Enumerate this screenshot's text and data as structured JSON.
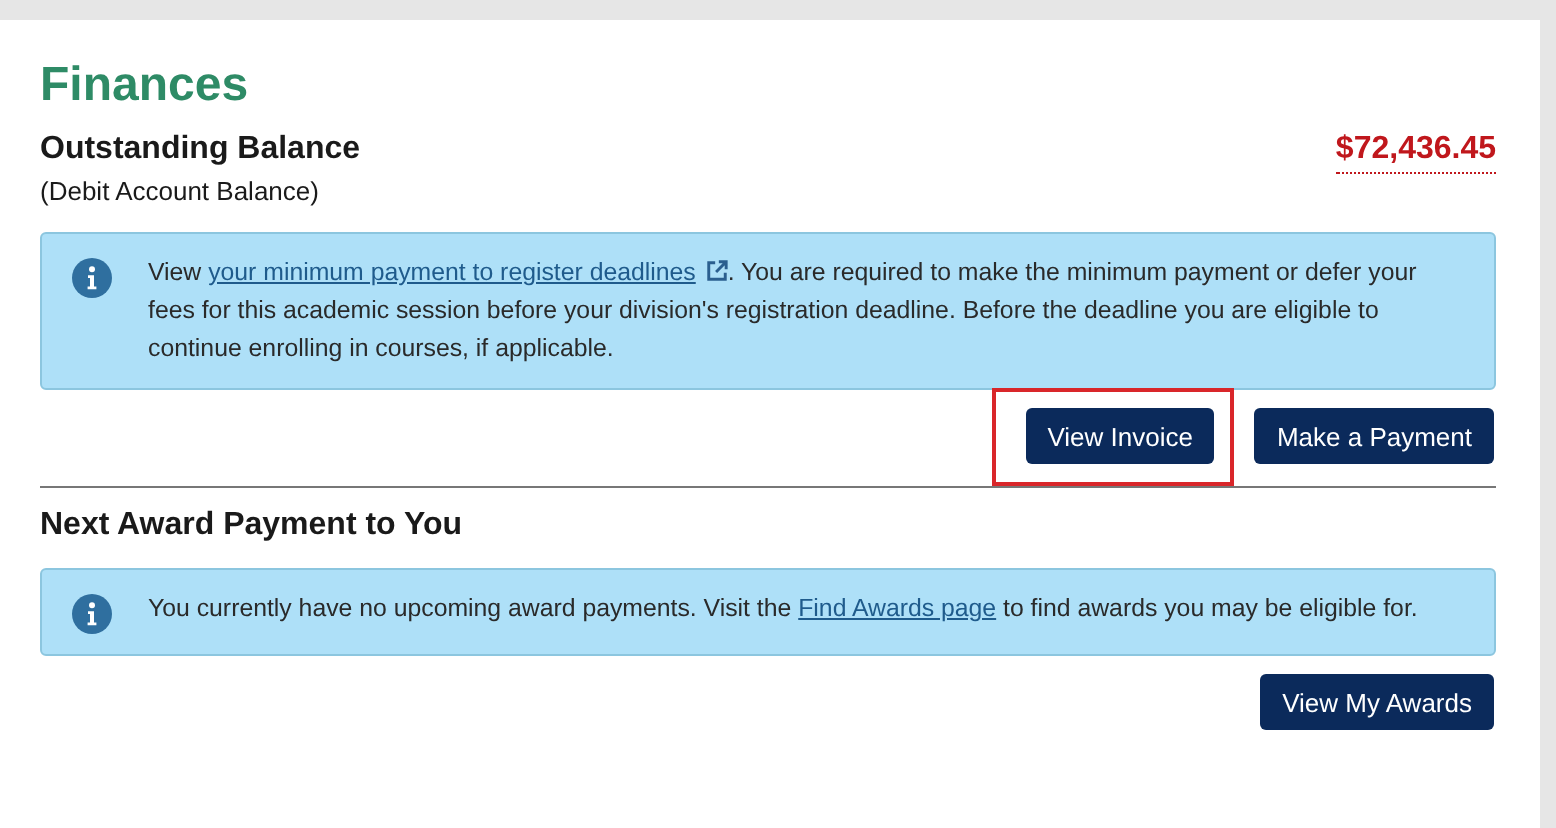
{
  "title": "Finances",
  "balance": {
    "label": "Outstanding Balance",
    "sublabel": "(Debit Account Balance)",
    "amount": "$72,436.45"
  },
  "balance_notice": {
    "before": "View ",
    "link": "your minimum payment to register deadlines",
    "external": true,
    "after": ". You are required to make the minimum payment or defer your fees for this academic session before your division's registration deadline. Before the deadline you are eligible to continue enrolling in courses, if applicable."
  },
  "balance_buttons": [
    {
      "label": "View Invoice",
      "highlighted": true
    },
    {
      "label": "Make a Payment",
      "highlighted": false
    }
  ],
  "award": {
    "heading": "Next Award Payment to You"
  },
  "award_notice": {
    "before": "You currently have no upcoming award payments. Visit the ",
    "link": "Find Awards page",
    "external": false,
    "after": " to find awards you may be eligible for."
  },
  "award_buttons": [
    {
      "label": "View My Awards",
      "highlighted": false
    }
  ]
}
